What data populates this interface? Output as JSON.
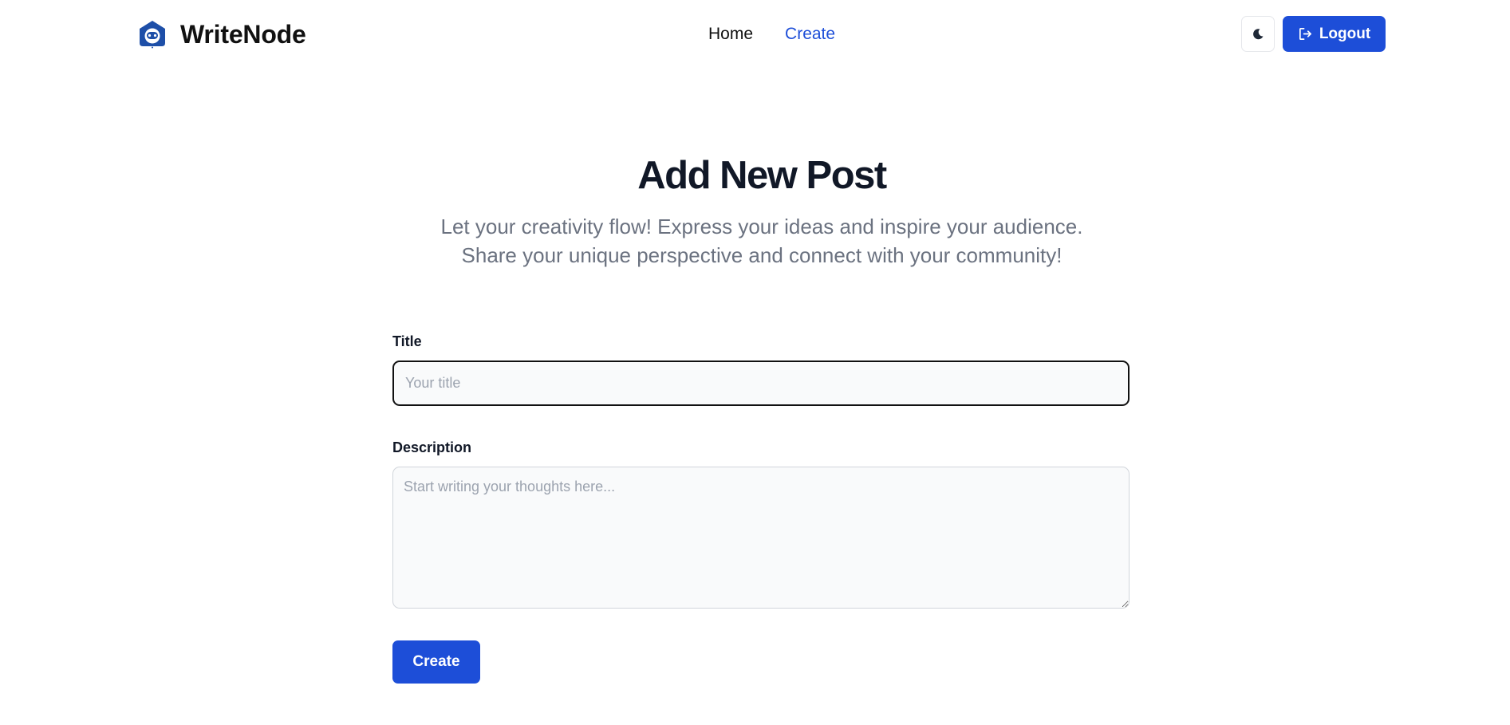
{
  "header": {
    "brand_name": "WriteNode",
    "logo_icon": "robot-home-icon",
    "nav": [
      {
        "label": "Home",
        "active": false
      },
      {
        "label": "Create",
        "active": true
      }
    ],
    "theme_toggle_icon": "moon-icon",
    "logout_label": "Logout",
    "logout_icon": "logout-icon"
  },
  "hero": {
    "title": "Add New Post",
    "subtitle_line1": "Let your creativity flow! Express your ideas and inspire your audience.",
    "subtitle_line2": "Share your unique perspective and connect with your community!"
  },
  "form": {
    "title_label": "Title",
    "title_value": "",
    "title_placeholder": "Your title",
    "description_label": "Description",
    "description_value": "",
    "description_placeholder": "Start writing your thoughts here...",
    "submit_label": "Create"
  },
  "colors": {
    "accent": "#1d4ed8",
    "heading": "#111827",
    "muted": "#6b7280"
  }
}
